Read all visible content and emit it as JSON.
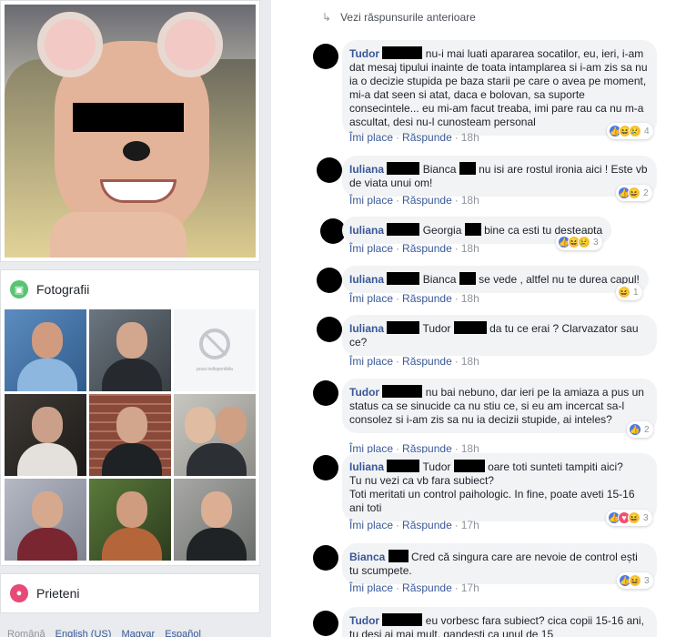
{
  "left": {
    "photos_title": "Fotografii",
    "unavailable_label": "poza indisponibila",
    "friends_title": "Prieteni",
    "footer_links": [
      "Română",
      "English (US)",
      "Magyar",
      "Español"
    ]
  },
  "thread": {
    "prev_replies": "Vezi răspunsurile anterioare",
    "like_label": "Îmi place",
    "reply_label": "Răspunde",
    "comments": [
      {
        "author": "Tudor",
        "text": "nu-i mai luati apararea socatilor, eu, ieri, i-am dat mesaj tipului inainte de toata intamplarea si i-am zis sa nu ia o decizie stupida pe baza starii pe care o avea pe moment, mi-a dat seen si atat, daca e bolovan, sa suporte consecintele... eu mi-am facut treaba, imi pare rau ca nu m-a ascultat, desi nu-l cunosteam personal",
        "time": "18h",
        "reactions": [
          "like",
          "haha",
          "sad"
        ],
        "count": "4"
      },
      {
        "author": "Iuliana",
        "mention": "Bianca",
        "text": "nu isi are rostul ironia aici ! Este vb de viata unui om!",
        "time": "18h",
        "reactions": [
          "like",
          "haha"
        ],
        "count": "2"
      },
      {
        "author": "Iuliana",
        "mention": "Georgia",
        "text": "bine ca esti tu desteapta",
        "time": "18h",
        "reactions": [
          "like",
          "haha",
          "sad"
        ],
        "count": "3"
      },
      {
        "author": "Iuliana",
        "mention": "Bianca",
        "text": "se vede , altfel nu te durea capul!",
        "time": "18h",
        "reactions": [
          "haha"
        ],
        "count": "1"
      },
      {
        "author": "Iuliana",
        "mention": "Tudor",
        "text": "da tu ce erai ? Clarvazator sau ce?",
        "time": "18h",
        "reactions": [],
        "count": ""
      },
      {
        "author": "Tudor",
        "text": "nu bai nebuno, dar ieri pe la amiaza a pus un status ca se sinucide ca nu stiu ce, si eu am incercat sa-l consolez si i-am zis sa nu ia decizii stupide, ai inteles?",
        "time": "18h",
        "reactions": [
          "like"
        ],
        "count": "2"
      },
      {
        "author": "Iuliana",
        "mention": "Tudor",
        "text": "oare toti sunteti tampiti aici?",
        "text2": "Tu nu vezi ca vb fara subiect?",
        "text3": "Toti meritati un control paihologic. In fine, poate aveti 15-16 ani toti",
        "time": "17h",
        "reactions": [
          "like",
          "love",
          "haha"
        ],
        "count": "3"
      },
      {
        "author": "Bianca",
        "text": "Cred că singura care are nevoie de control ești tu scumpete.",
        "time": "17h",
        "reactions": [
          "like",
          "haha"
        ],
        "count": "3"
      },
      {
        "author": "Tudor",
        "text": "eu vorbesc fara subiect? cica copii 15-16 ani, tu desi ai mai mult, gandesti ca unul de 15"
      }
    ]
  },
  "colors": {
    "link": "#385898",
    "bubble": "#f2f3f5",
    "like": "#4a79e5"
  }
}
